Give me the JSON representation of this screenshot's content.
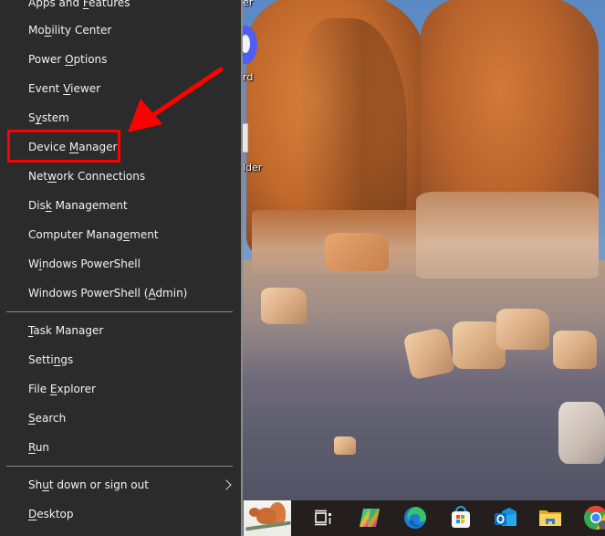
{
  "menu": {
    "items": [
      {
        "id": "apps-features",
        "label": "Apps and Features",
        "underline_index": 9
      },
      {
        "id": "mobility-center",
        "label": "Mobility Center",
        "underline_index": 2
      },
      {
        "id": "power-options",
        "label": "Power Options",
        "underline_index": 6
      },
      {
        "id": "event-viewer",
        "label": "Event Viewer",
        "underline_index": 6
      },
      {
        "id": "system",
        "label": "System",
        "underline_index": 1
      },
      {
        "id": "device-manager",
        "label": "Device Manager",
        "underline_index": 7
      },
      {
        "id": "network-connections",
        "label": "Network Connections",
        "underline_index": 3
      },
      {
        "id": "disk-management",
        "label": "Disk Management",
        "underline_index": 3
      },
      {
        "id": "computer-management",
        "label": "Computer Management",
        "underline_index": 14
      },
      {
        "id": "windows-powershell",
        "label": "Windows PowerShell",
        "underline_index": 1
      },
      {
        "id": "windows-powershell-admin",
        "label": "Windows PowerShell (Admin)",
        "underline_index": 20
      },
      {
        "id": "task-manager",
        "label": "Task Manager",
        "underline_index": 0
      },
      {
        "id": "settings",
        "label": "Settings",
        "underline_index": 5
      },
      {
        "id": "file-explorer",
        "label": "File Explorer",
        "underline_index": 5
      },
      {
        "id": "search",
        "label": "Search",
        "underline_index": 0
      },
      {
        "id": "run",
        "label": "Run",
        "underline_index": 0
      },
      {
        "id": "shut-down-sign-out",
        "label": "Shut down or sign out",
        "underline_index": 2,
        "has_submenu": true
      },
      {
        "id": "desktop",
        "label": "Desktop",
        "underline_index": 0
      }
    ],
    "highlighted_item": "Device Manager"
  },
  "annotation": {
    "color": "#ff0000",
    "target": "Device Manager"
  },
  "desktop": {
    "icon_label_fragments": [
      "er",
      "rd",
      "lder"
    ]
  },
  "taskbar": {
    "items": [
      {
        "name": "widgets",
        "icon": "squirrel-widget-icon"
      },
      {
        "name": "task-view",
        "icon": "task-view-icon"
      },
      {
        "name": "copilot",
        "icon": "copilot-icon"
      },
      {
        "name": "microsoft-edge",
        "icon": "edge-icon"
      },
      {
        "name": "microsoft-store",
        "icon": "store-icon"
      },
      {
        "name": "outlook",
        "icon": "outlook-icon"
      },
      {
        "name": "file-explorer",
        "icon": "folder-icon"
      },
      {
        "name": "google-chrome",
        "icon": "chrome-icon"
      }
    ]
  },
  "colors": {
    "menu_bg": "#2b2b2b",
    "menu_text": "#f2f2f2",
    "separator": "#8a8a8a",
    "taskbar_bg": "#241e1c",
    "highlight": "#ff0000"
  }
}
